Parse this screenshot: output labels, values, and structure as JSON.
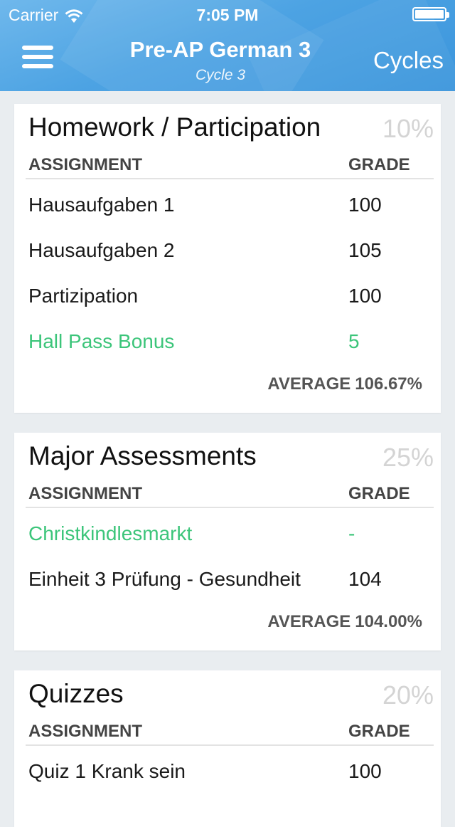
{
  "status": {
    "carrier": "Carrier",
    "time": "7:05 PM"
  },
  "nav": {
    "title": "Pre-AP German 3",
    "subtitle": "Cycle 3",
    "cycles_label": "Cycles"
  },
  "columns": {
    "assignment": "ASSIGNMENT",
    "grade": "GRADE"
  },
  "average_label": "AVERAGE",
  "colors": {
    "header_blue": "#4da3e3",
    "bonus_green": "#3cc57a"
  },
  "categories": [
    {
      "title": "Homework / Participation",
      "weight": "10%",
      "rows": [
        {
          "name": "Hausaufgaben 1",
          "grade": "100"
        },
        {
          "name": "Hausaufgaben 2",
          "grade": "105"
        },
        {
          "name": "Partizipation",
          "grade": "100"
        },
        {
          "name": "Hall Pass Bonus",
          "grade": "5"
        }
      ],
      "average": "106.67%"
    },
    {
      "title": "Major Assessments",
      "weight": "25%",
      "rows": [
        {
          "name": "Christkindlesmarkt",
          "grade": "-"
        },
        {
          "name": "Einheit 3 Prüfung - Gesundheit",
          "grade": "104"
        }
      ],
      "average": "104.00%"
    },
    {
      "title": "Quizzes",
      "weight": "20%",
      "rows": [
        {
          "name": "Quiz 1 Krank sein",
          "grade": "100"
        }
      ]
    }
  ]
}
